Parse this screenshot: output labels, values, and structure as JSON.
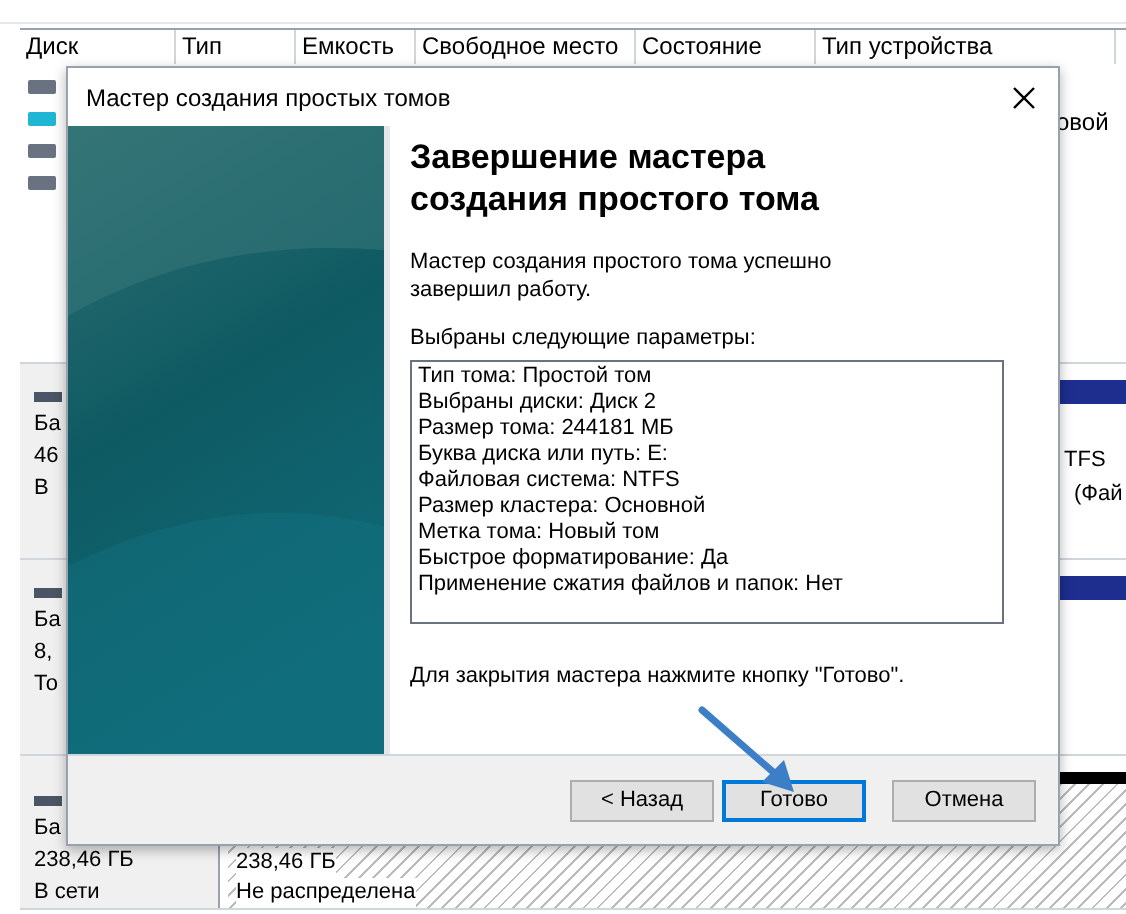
{
  "background": {
    "columns": [
      "Диск",
      "Тип",
      "Емкость",
      "Свободное место",
      "Состояние",
      "Тип устройства"
    ],
    "list_right_texts": [
      "овой"
    ],
    "volume_right_texts": [
      "TFS",
      "(Фай"
    ],
    "disks": [
      {
        "lines": [
          "Ба",
          "46",
          "В"
        ]
      },
      {
        "lines": [
          "Ба",
          "8,",
          "То"
        ]
      },
      {
        "lines": [
          "Ба",
          "238,46 ГБ",
          "В сети"
        ],
        "partition": [
          "238,46 ГБ",
          "Не распределена"
        ]
      }
    ]
  },
  "dialog": {
    "title": "Мастер создания простых томов",
    "heading": "Завершение мастера создания простого тома",
    "intro": "Мастер создания простого тома успешно завершил работу.",
    "params_label": "Выбраны следующие параметры:",
    "params": [
      "Тип тома: Простой том",
      "Выбраны диски: Диск 2",
      "Размер тома: 244181 МБ",
      "Буква диска или путь: E:",
      "Файловая система: NTFS",
      "Размер кластера: Основной",
      "Метка тома: Новый том",
      "Быстрое форматирование: Да",
      "Применение сжатия файлов и папок: Нет"
    ],
    "closing": "Для закрытия мастера нажмите кнопку \"Готово\".",
    "buttons": [
      {
        "label": "< Назад",
        "selected": false
      },
      {
        "label": "Готово",
        "selected": true
      },
      {
        "label": "Отмена",
        "selected": false
      }
    ]
  }
}
